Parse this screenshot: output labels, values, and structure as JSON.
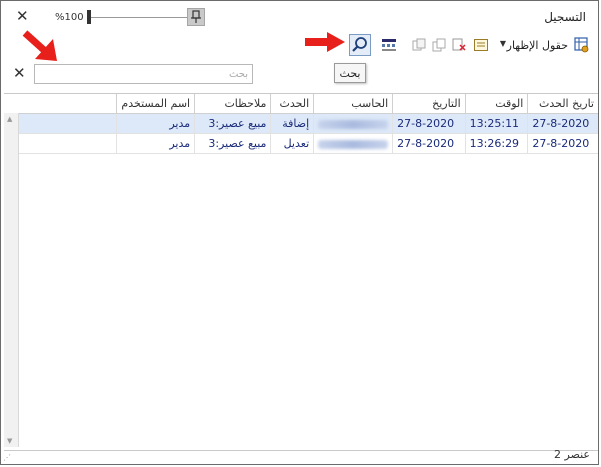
{
  "window": {
    "title": "التسجيل"
  },
  "titlebar": {
    "zoom_label": "%100",
    "close_glyph": "✕"
  },
  "toolbar": {
    "fields_label": "حقول الإظهار",
    "icons": [
      "fields-icon",
      "form-icon",
      "delete-icon",
      "copy-icon",
      "paste-icon",
      "columns-icon",
      "search-icon"
    ]
  },
  "tooltip": {
    "text": "بحث"
  },
  "search": {
    "placeholder": "بحث",
    "value": "",
    "close_glyph": "✕"
  },
  "table": {
    "headers": [
      "تاريخ الحدث",
      "الوقت",
      "التاريخ",
      "الحاسب",
      "الحدث",
      "ملاحظات",
      "اسم المستخدم"
    ],
    "rows": [
      {
        "event_date": "27-8-2020",
        "time": "13:25:11",
        "date": "27-8-2020",
        "event": "إضافة",
        "notes": "مبيع عصير:3",
        "user": "مدير"
      },
      {
        "event_date": "27-8-2020",
        "time": "13:26:29",
        "date": "27-8-2020",
        "event": "تعديل",
        "notes": "مبيع عصير:3",
        "user": "مدير"
      }
    ]
  },
  "status": {
    "count_text": "2 عنصر"
  },
  "colors": {
    "accent_red": "#e8201c",
    "selection": "#dde9f8",
    "text_blue": "#1a2b7a"
  }
}
